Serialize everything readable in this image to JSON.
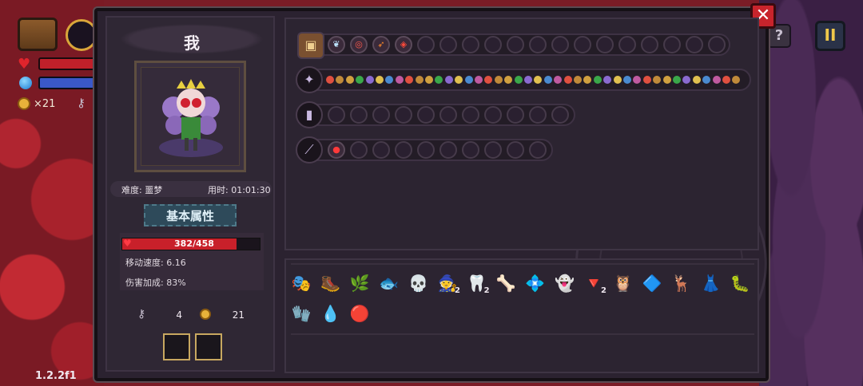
{
  "hud": {
    "coin_count": "×21",
    "version": "1.2.2f1"
  },
  "buttons": {
    "pause": "II",
    "help": "?",
    "close": "✕"
  },
  "character": {
    "name": "我",
    "difficulty": "难度: 噩梦",
    "time": "用时: 01:01:30",
    "attr_title": "基本属性",
    "hp_text": "382/458",
    "hp_fraction": 0.834,
    "move_speed": "移动速度: 6.16",
    "damage_bonus": "伤害加成: 83%",
    "keys": "4",
    "coins": "21"
  },
  "equipment_rows": [
    {
      "slot": "chest",
      "gems": [
        "butterfly",
        "target",
        "fire-dart",
        "flame-diamond"
      ],
      "empty": 14
    },
    {
      "slot": "wand",
      "mini_count": 42
    },
    {
      "slot": "cannon",
      "gems": [],
      "empty": 11
    },
    {
      "slot": "staff",
      "gems": [
        "bomb"
      ],
      "empty": 9
    }
  ],
  "items": [
    {
      "name": "purple-hair-mask",
      "glyph": "🎭",
      "count": ""
    },
    {
      "name": "green-boot",
      "glyph": "🥾",
      "count": ""
    },
    {
      "name": "green-claw",
      "glyph": "🌿",
      "count": ""
    },
    {
      "name": "red-eye-fish",
      "glyph": "🐟",
      "count": ""
    },
    {
      "name": "dark-skull",
      "glyph": "💀",
      "count": ""
    },
    {
      "name": "witch-hat",
      "glyph": "🧙",
      "count": "2"
    },
    {
      "name": "fangs",
      "glyph": "🦷",
      "count": "2"
    },
    {
      "name": "ribcage",
      "glyph": "🦴",
      "count": ""
    },
    {
      "name": "green-gem-box",
      "glyph": "💠",
      "count": ""
    },
    {
      "name": "gray-ghost",
      "glyph": "👻",
      "count": ""
    },
    {
      "name": "yellow-cone",
      "glyph": "🔻",
      "count": "2"
    },
    {
      "name": "dark-owl",
      "glyph": "🦉",
      "count": ""
    },
    {
      "name": "blue-mirror",
      "glyph": "🔷",
      "count": ""
    },
    {
      "name": "gold-antler",
      "glyph": "🦌",
      "count": ""
    },
    {
      "name": "purple-dress",
      "glyph": "👗",
      "count": ""
    },
    {
      "name": "green-worm",
      "glyph": "🐛",
      "count": ""
    },
    {
      "name": "gold-gauntlet",
      "glyph": "🧤",
      "count": ""
    },
    {
      "name": "blue-drop",
      "glyph": "💧",
      "count": ""
    },
    {
      "name": "red-eye",
      "glyph": "🔴",
      "count": ""
    }
  ]
}
